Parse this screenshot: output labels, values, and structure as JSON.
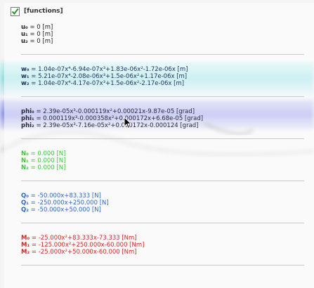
{
  "header": {
    "title": "[functions]",
    "checked": true
  },
  "displacement": [
    {
      "label": "u₀",
      "expr": " = 0 [m]"
    },
    {
      "label": "u₁",
      "expr": " = 0 [m]"
    },
    {
      "label": "u₂",
      "expr": " = 0 [m]"
    }
  ],
  "deflection": [
    {
      "label": "w₀",
      "expr": " = 1.04e-07x⁴-6.94e-07x³+1.83e-06x²-1.72e-06x [m]"
    },
    {
      "label": "w₁",
      "expr": " = 5.21e-07x⁴-2.08e-06x³+1.5e-06x²+1.17e-06x [m]"
    },
    {
      "label": "w₂",
      "expr": " = 1.04e-07x⁴-4.17e-07x³+1.5e-06x²-2.17e-06x [m]"
    }
  ],
  "rotation": [
    {
      "label": "phi₀",
      "expr": " = 2.39e-05x³-0.000119x²+0.00021x-9.87e-05 [grad]"
    },
    {
      "label": "phi₁",
      "expr": " = 0.000119x³-0.000358x²+0.000172x+6.68e-05 [grad]"
    },
    {
      "label": "phi₂",
      "expr": " = 2.39e-05x³-7.16e-05x²+0.000172x-0.000124 [grad]"
    }
  ],
  "normal_force": [
    {
      "label": "N₀",
      "expr": " = 0.000 [N]"
    },
    {
      "label": "N₁",
      "expr": " = 0.000 [N]"
    },
    {
      "label": "N₂",
      "expr": " = 0.000 [N]"
    }
  ],
  "shear_force": [
    {
      "label": "Q₀",
      "expr": " = -50.000x+83.333 [N]"
    },
    {
      "label": "Q₁",
      "expr": " = -250.000x+250.000 [N]"
    },
    {
      "label": "Q₂",
      "expr": " = -50.000x+50.000 [N]"
    }
  ],
  "moment": [
    {
      "label": "M₀",
      "expr": " = -25.000x²+83.333x-73.333 [Nm]"
    },
    {
      "label": "M₁",
      "expr": " = -125.000x²+250.000x-60.000 [Nm]"
    },
    {
      "label": "M₂",
      "expr": " = -25.000x²+50.000x-60.000 [Nm]"
    }
  ],
  "colors": {
    "normal_force": "#33cc33",
    "shear_force": "#2a66cc",
    "moment": "#dd1f1f",
    "highlight_band_top": "#36c9d0",
    "highlight_band_bottom": "#5a63e0"
  },
  "icons": {
    "checkbox": "checkmark-icon",
    "cursor": "mouse-pointer-icon"
  }
}
